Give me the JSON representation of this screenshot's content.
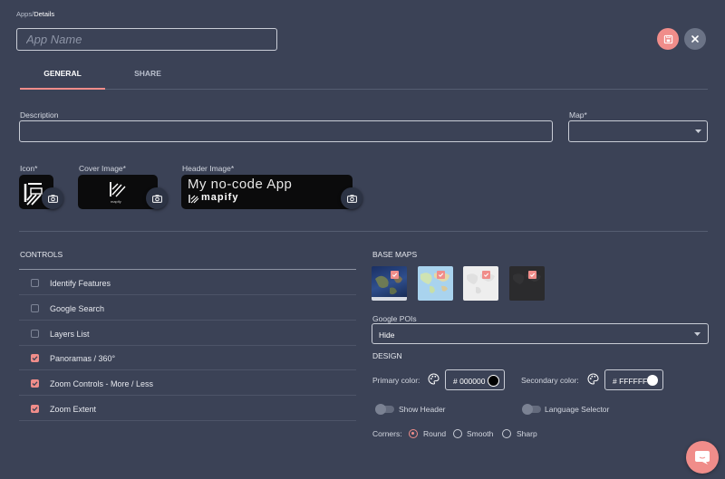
{
  "breadcrumb": {
    "parent": "Apps/",
    "current": "Details"
  },
  "app_name": {
    "placeholder": "App Name",
    "value": ""
  },
  "tabs": [
    {
      "label": "GENERAL",
      "active": true
    },
    {
      "label": "SHARE",
      "active": false
    }
  ],
  "form": {
    "description_label": "Description",
    "description_value": "",
    "map_label": "Map*",
    "map_value": "",
    "icon_label": "Icon*",
    "cover_label": "Cover Image*",
    "header_label": "Header Image*",
    "header_image_title": "My no-code App",
    "brand": "mapify",
    "cover_brand": "mapify"
  },
  "controls": {
    "title": "CONTROLS",
    "items": [
      {
        "label": "Identify Features",
        "checked": false
      },
      {
        "label": "Google Search",
        "checked": false
      },
      {
        "label": "Layers List",
        "checked": false
      },
      {
        "label": "Panoramas / 360°",
        "checked": true
      },
      {
        "label": "Zoom Controls - More / Less",
        "checked": true
      },
      {
        "label": "Zoom Extent",
        "checked": true
      }
    ]
  },
  "base_maps": {
    "title": "BASE MAPS",
    "items": [
      {
        "name": "satellite",
        "selected": true
      },
      {
        "name": "terrain",
        "selected": true
      },
      {
        "name": "light",
        "selected": true
      },
      {
        "name": "dark",
        "selected": true
      }
    ]
  },
  "google_pois": {
    "label": "Google POIs",
    "value": "Hide"
  },
  "design": {
    "title": "DESIGN",
    "primary_label": "Primary color:",
    "primary_value": "# 000000",
    "primary_swatch": "#000000",
    "secondary_label": "Secondary color:",
    "secondary_value": "# FFFFFF",
    "secondary_swatch": "#ffffff",
    "show_header_label": "Show Header",
    "language_selector_label": "Language Selector",
    "corners_label": "Corners:",
    "corners_options": [
      "Round",
      "Smooth",
      "Sharp"
    ],
    "corners_selected": "Round"
  },
  "colors": {
    "accent": "#f08d8a",
    "background": "#3b4256"
  }
}
